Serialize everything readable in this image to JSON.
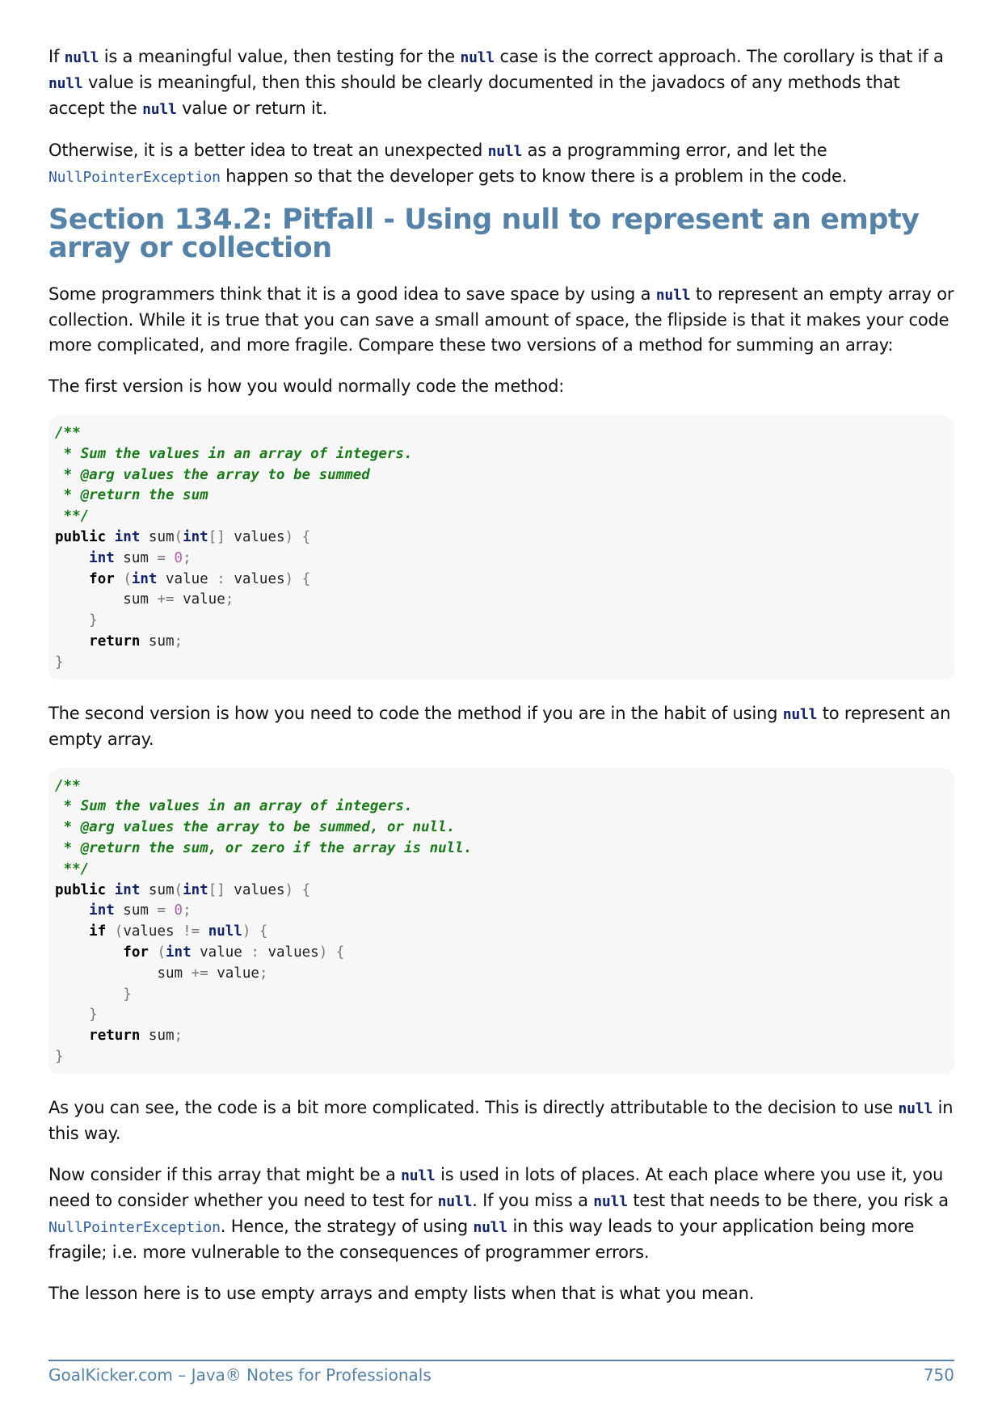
{
  "para1": {
    "t1": "If ",
    "c1": "null",
    "t2": " is a meaningful value, then testing for the ",
    "c2": "null",
    "t3": " case is the correct approach. The corollary is that if a ",
    "c3": "null",
    "t4": " value is meaningful, then this should be clearly documented in the javadocs of any methods that accept the ",
    "c4": "null",
    "t5": " value or return it."
  },
  "para2": {
    "t1": "Otherwise, it is a better idea to treat an unexpected ",
    "c1": "null",
    "t2": " as a programming error, and let the ",
    "l1": "NullPointerException",
    "t3": " happen so that the developer gets to know there is a problem in the code."
  },
  "section_title": "Section 134.2: Pitfall - Using null to represent an empty array or collection",
  "para3": {
    "t1": "Some programmers think that it is a good idea to save space by using a ",
    "c1": "null",
    "t2": " to represent an empty array or collection. While it is true that you can save a small amount of space, the flipside is that it makes your code more complicated, and more fragile. Compare these two versions of a method for summing an array:"
  },
  "para4": "The first version is how you would normally code the method:",
  "code1": {
    "c1": "/**",
    "c2": " * Sum the values in an array of integers.",
    "c3": " * @arg values the array to be summed",
    "c4": " * @return the sum",
    "c5": " **/",
    "kw_public": "public",
    "ty_int": "int",
    "sig_name": " sum",
    "ty_int2": "int",
    "sig_rest": " values",
    "ty_int3": "int",
    "l_sum": " sum ",
    "zero": "0",
    "kw_for": "for",
    "ty_int4": "int",
    "l_value": " value ",
    "l_values": " values",
    "l_sumadd": "sum ",
    "l_value2": " value",
    "kw_return": "return",
    "l_ret": " sum"
  },
  "para5": {
    "t1": "The second version is how you need to code the method if you are in the habit of using ",
    "c1": "null",
    "t2": " to represent an empty array."
  },
  "code2": {
    "c1": "/**",
    "c2": " * Sum the values in an array of integers.",
    "c3": " * @arg values the array to be summed, or null.",
    "c4": " * @return the sum, or zero if the array is null.",
    "c5": " **/",
    "kw_public": "public",
    "ty_int": "int",
    "sig_name": " sum",
    "ty_int2": "int",
    "sig_rest": " values",
    "ty_int3": "int",
    "l_sum": " sum ",
    "zero": "0",
    "kw_if": "if",
    "l_values_if": "values ",
    "kw_null": "null",
    "kw_for": "for",
    "ty_int4": "int",
    "l_value": " value ",
    "l_values": " values",
    "l_sumadd": "sum ",
    "l_value2": " value",
    "kw_return": "return",
    "l_ret": " sum"
  },
  "para6": {
    "t1": "As you can see, the code is a bit more complicated. This is directly attributable to the decision to use ",
    "c1": "null",
    "t2": " in this way."
  },
  "para7": {
    "t1": "Now consider if this array that might be a ",
    "c1": "null",
    "t2": " is used in lots of places. At each place where you use it, you need to consider whether you need to test for ",
    "c2": "null",
    "t3": ". If you miss a ",
    "c3": "null",
    "t4": " test that needs to be there, you risk a ",
    "l1": "NullPointerException",
    "t5": ". Hence, the strategy of using ",
    "c4": "null",
    "t6": " in this way leads to your application being more fragile; i.e. more vulnerable to the consequences of programmer errors."
  },
  "para8": "The lesson here is to use empty arrays and empty lists when that is what you mean.",
  "footer": {
    "left": "GoalKicker.com – Java® Notes for Professionals",
    "right": "750"
  }
}
